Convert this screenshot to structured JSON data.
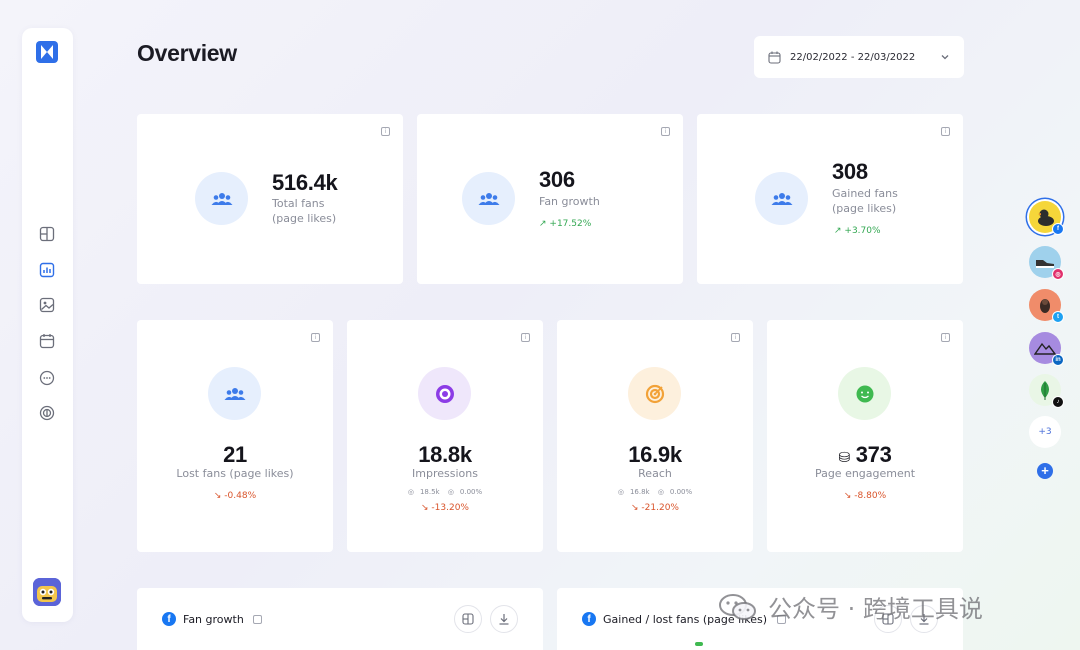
{
  "header": {
    "title": "Overview",
    "date_range": "22/02/2022 - 22/03/2022"
  },
  "sidebar": {
    "items": [
      {
        "icon": "dashboard-icon"
      },
      {
        "icon": "analytics-icon",
        "active": true
      },
      {
        "icon": "media-icon"
      },
      {
        "icon": "calendar-icon"
      },
      {
        "icon": "chat-icon"
      },
      {
        "icon": "listening-icon"
      }
    ]
  },
  "top_cards": [
    {
      "value": "516.4k",
      "label1": "Total fans",
      "label2": "(page likes)",
      "delta": ""
    },
    {
      "value": "306",
      "label1": "Fan growth",
      "label2": "",
      "delta": "+17.52%"
    },
    {
      "value": "308",
      "label1": "Gained fans",
      "label2": "(page likes)",
      "delta": "+3.70%"
    }
  ],
  "mid_cards": [
    {
      "value": "21",
      "label": "Lost fans (page likes)",
      "delta": "-0.48%"
    },
    {
      "value": "18.8k",
      "label": "Impressions",
      "mini1": "18.5k",
      "mini2": "0.00%",
      "delta": "-13.20%"
    },
    {
      "value": "16.9k",
      "label": "Reach",
      "mini1": "16.8k",
      "mini2": "0.00%",
      "delta": "-21.20%"
    },
    {
      "value": "373",
      "label": "Page engagement",
      "delta": "-8.80%"
    }
  ],
  "bottom_panels": [
    {
      "title": "Fan growth"
    },
    {
      "title": "Gained / lost fans (page likes)"
    }
  ],
  "channels": {
    "more_label": "+3",
    "add_label": "+"
  },
  "watermark": "公众号 · 跨境工具说",
  "colors": {
    "accent": "#2f6fe8",
    "positive": "#34a853",
    "negative": "#d9542b",
    "fans_circle": "#e6effd",
    "impressions_circle": "#efe7fb",
    "reach_circle": "#fdf0dd",
    "engagement_circle": "#e8f7e5"
  }
}
